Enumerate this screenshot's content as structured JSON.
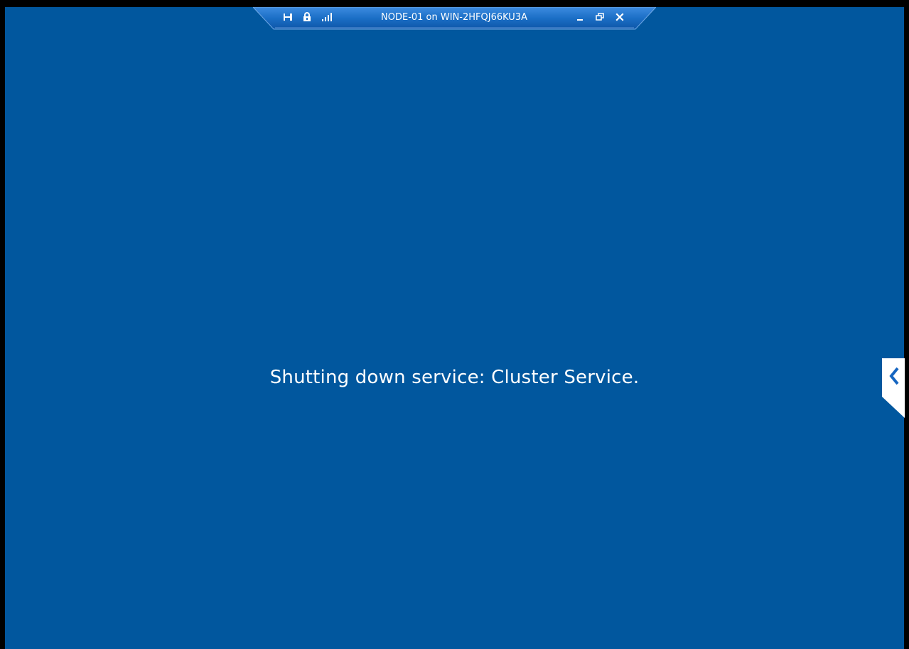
{
  "window": {
    "title": "NODE-01 on WIN-2HFQJ66KU3A"
  },
  "screen": {
    "background_color": "#01579e",
    "status_message": "Shutting down service: Cluster Service."
  },
  "connection_bar": {
    "icons": [
      "pin-icon",
      "lock-icon",
      "signal-bars-icon",
      "minimize-icon",
      "restore-icon",
      "close-icon"
    ],
    "accent_color": "#1b6fc6"
  },
  "side_panel": {
    "icon": "chevron-left-icon"
  }
}
